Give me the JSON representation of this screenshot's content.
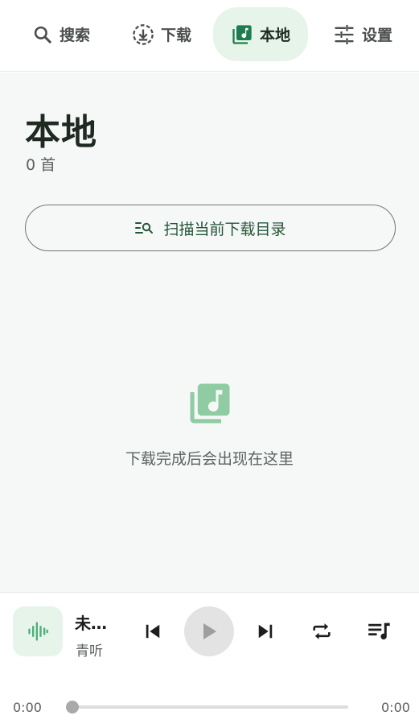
{
  "nav": {
    "items": [
      {
        "label": "搜索",
        "icon": "search-icon"
      },
      {
        "label": "下载",
        "icon": "download-icon"
      },
      {
        "label": "本地",
        "icon": "library-music-icon"
      },
      {
        "label": "设置",
        "icon": "sliders-icon"
      }
    ],
    "active": "本地"
  },
  "main": {
    "title": "本地",
    "count_text": "0 首",
    "scan_button_label": "扫描当前下载目录",
    "empty_icon": "library-music-icon",
    "empty_text": "下载完成后会出现在这里"
  },
  "player": {
    "cover_icon": "waveform-icon",
    "title": "未…",
    "artist": "青听",
    "controls": [
      "previous-icon",
      "play-icon",
      "next-icon",
      "repeat-icon",
      "queue-music-icon"
    ],
    "time_elapsed": "0:00",
    "time_total": "0:00",
    "progress": 0
  },
  "colors": {
    "accent": "#2e8b57",
    "accent_soft": "#e6f4ea",
    "background": "#f6f8f7",
    "empty_icon": "#8fcca3"
  }
}
